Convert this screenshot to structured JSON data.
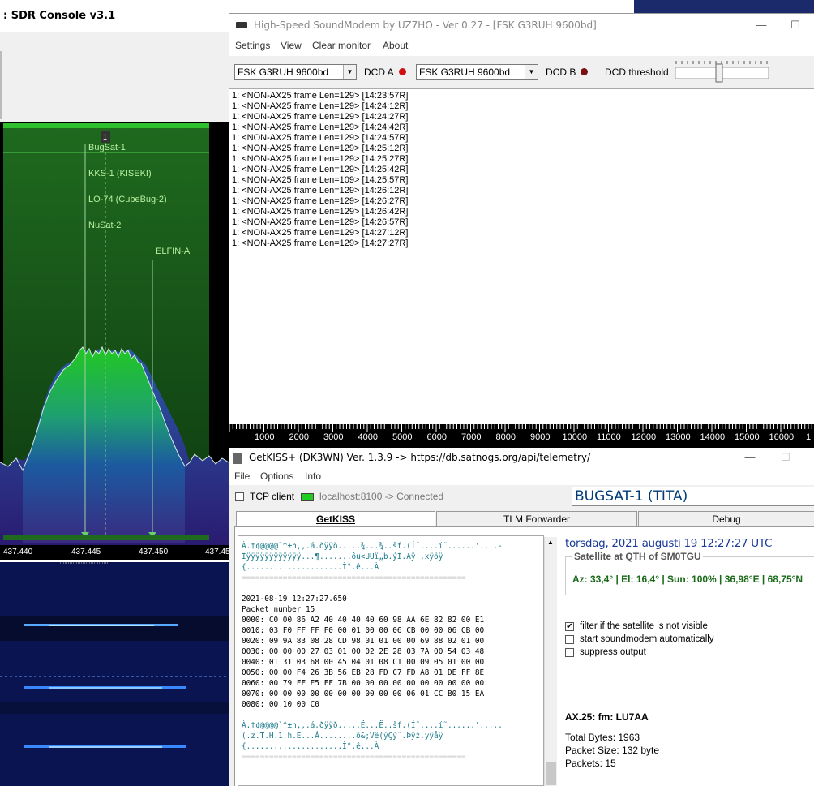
{
  "sdr": {
    "title": ": SDR Console v3.1",
    "marker_number": "1",
    "satellite_labels": [
      "BugSat-1",
      "KKS-1 (KISEKI)",
      "LO-74 (CubeBug-2)",
      "NuSat-2",
      "ELFIN-A"
    ],
    "freq_ticks": [
      "437.440",
      "437.445",
      "437.450",
      "437.45"
    ]
  },
  "soundmodem": {
    "title": "High-Speed SoundModem by UZ7HO - Ver 0.27 - [FSK G3RUH 9600bd]",
    "menu": [
      "Settings",
      "View",
      "Clear monitor",
      "About"
    ],
    "modem_a": "FSK G3RUH 9600bd",
    "dcd_a_label": "DCD A",
    "modem_b": "FSK G3RUH 9600bd",
    "dcd_b_label": "DCD B",
    "dcd_threshold_label": "DCD threshold",
    "led_a_color": "#d01010",
    "led_b_color": "#7a1010",
    "monitor_lines": [
      "1: <NON-AX25 frame Len=129> [14:23:57R]",
      "1: <NON-AX25 frame Len=129> [14:24:12R]",
      "1: <NON-AX25 frame Len=129> [14:24:27R]",
      "1: <NON-AX25 frame Len=129> [14:24:42R]",
      "1: <NON-AX25 frame Len=129> [14:24:57R]",
      "1: <NON-AX25 frame Len=129> [14:25:12R]",
      "1: <NON-AX25 frame Len=129> [14:25:27R]",
      "1: <NON-AX25 frame Len=129> [14:25:42R]",
      "1: <NON-AX25 frame Len=109> [14:25:57R]",
      "1: <NON-AX25 frame Len=129> [14:26:12R]",
      "1: <NON-AX25 frame Len=129> [14:26:27R]",
      "1: <NON-AX25 frame Len=129> [14:26:42R]",
      "1: <NON-AX25 frame Len=129> [14:26:57R]",
      "1: <NON-AX25 frame Len=129> [14:27:12R]",
      "1: <NON-AX25 frame Len=129> [14:27:27R]"
    ],
    "scale_ticks": [
      "1000",
      "2000",
      "3000",
      "4000",
      "5000",
      "6000",
      "7000",
      "8000",
      "9000",
      "10000",
      "11000",
      "12000",
      "13000",
      "14000",
      "15000",
      "16000",
      "1"
    ]
  },
  "getkiss": {
    "title": "GetKISS+ (DK3WN) Ver. 1.3.9 -> https://db.satnogs.org/api/telemetry/",
    "menu": [
      "File",
      "Options",
      "Info"
    ],
    "tcp_client_label": "TCP client",
    "connection_status": "localhost:8100 -> Connected",
    "connection_color": "#22cc22",
    "satellite_name": "BUGSAT-1 (TITA)",
    "tabs": [
      "GetKISS",
      "TLM Forwarder",
      "Debug"
    ],
    "log_lines": [
      {
        "text": "À.†¢@@@@`^±n,,.á.ðÿÿð.....¾...¾..šf.(Í˜....í˜......'....-",
        "style": "teal"
      },
      {
        "text": "Îÿÿÿÿÿÿÿÿÿÿÿÿ...¶.......ôu<ÜÜï„b.ýÌ.Äÿ .xÿöÿ",
        "style": "teal"
      },
      {
        "text": "{.....................Ì°.ê...À",
        "style": "teal"
      },
      {
        "text": "=================================================",
        "style": "grey"
      },
      {
        "text": "",
        "style": "normal"
      },
      {
        "text": "2021-08-19 12:27:27.650",
        "style": "normal"
      },
      {
        "text": "Packet number 15",
        "style": "normal"
      },
      {
        "text": "0000: C0 00 86 A2 40 40 40 40 60 98 AA 6E 82 82 00 E1",
        "style": "normal"
      },
      {
        "text": "0010: 03 F0 FF FF F0 00 01 00 00 06 CB 00 00 06 CB 00",
        "style": "normal"
      },
      {
        "text": "0020: 09 9A 83 08 28 CD 98 01 01 00 00 69 88 02 01 00",
        "style": "normal"
      },
      {
        "text": "0030: 00 00 00 27 03 01 00 02 2E 28 03 7A 00 54 03 48",
        "style": "normal"
      },
      {
        "text": "0040: 01 31 03 68 00 45 04 01 08 C1 00 09 05 01 00 00",
        "style": "normal"
      },
      {
        "text": "0050: 00 00 F4 26 3B 56 EB 28 FD C7 FD A8 01 DE FF 8E",
        "style": "normal"
      },
      {
        "text": "0060: 00 79 FF E5 FF 7B 00 00 00 00 00 00 00 00 00 00",
        "style": "normal"
      },
      {
        "text": "0070: 00 00 00 00 00 00 00 00 00 00 06 01 CC B0 15 EA",
        "style": "normal"
      },
      {
        "text": "0080: 00 10 00 C0",
        "style": "normal"
      },
      {
        "text": "",
        "style": "normal"
      },
      {
        "text": "À.†¢@@@@`^±n,,.á.ðÿÿð.....Ë...Ë..šf.(Í˜....í˜......'.....",
        "style": "teal"
      },
      {
        "text": "(.z.T.H.1.h.E...Á........ô&;Vë(ýÇý¨.Þÿž.yÿåÿ",
        "style": "teal"
      },
      {
        "text": "{.....................Ì°.ê...À",
        "style": "teal"
      },
      {
        "text": "=================================================",
        "style": "grey"
      }
    ],
    "datetime": "torsdag, 2021 augusti 19  12:27:27 UTC",
    "sat_qth_caption": "Satellite at QTH of SM0TGU",
    "sat_qth_value": "Az: 33,4° | El: 16,4° | Sun: 100% | 36,98°E | 68,75°N",
    "options": [
      {
        "label": "filter if the satellite is not visible",
        "checked": true
      },
      {
        "label": "start soundmodem automatically",
        "checked": false
      },
      {
        "label": "suppress output",
        "checked": false
      }
    ],
    "ax25": "AX.25: fm: LU7AA",
    "total_bytes": "Total Bytes: 1963",
    "packet_size": "Packet Size: 132 byte",
    "packets": "Packets: 15"
  }
}
